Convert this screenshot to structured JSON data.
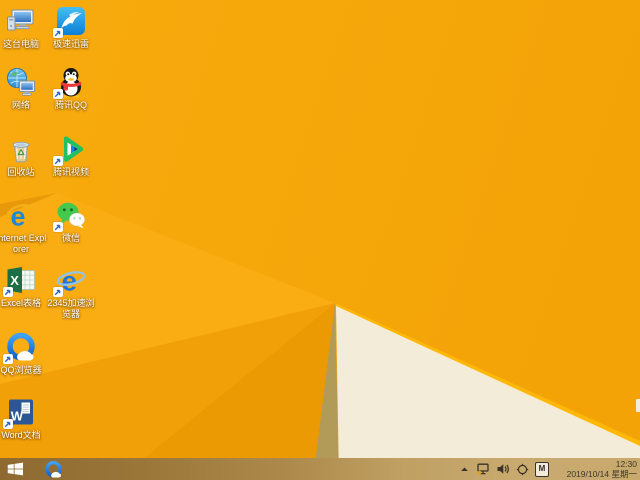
{
  "wallpaper": {
    "base_color": "#f7a90b",
    "base_color_right": "#f3a306",
    "facet_bright": "#f9ad12",
    "facet_crease": "#e8990a",
    "facet_mid": "#f2a008",
    "facet_dark": "#ec9a03",
    "fold_shadow": "#b29a58",
    "fold_cream": "#f3ecd8",
    "fold_edge_highlight": "#ffb808"
  },
  "desktop": {
    "icons": [
      {
        "label": "这台电脑",
        "icon": "this-pc"
      },
      {
        "label": "极速迅雷",
        "icon": "xunlei"
      },
      {
        "label": "网络",
        "icon": "network"
      },
      {
        "label": "腾讯QQ",
        "icon": "qq"
      },
      {
        "label": "回收站",
        "icon": "recycle-bin"
      },
      {
        "label": "腾讯视频",
        "icon": "tencent-video"
      },
      {
        "label": "Internet Explorer",
        "icon": "internet-explorer"
      },
      {
        "label": "微信",
        "icon": "wechat"
      },
      {
        "label": "Excel表格",
        "icon": "excel"
      },
      {
        "label": "2345加速浏览器",
        "icon": "browser-2345"
      },
      {
        "label": "QQ浏览器",
        "icon": "qq-browser"
      },
      {
        "label": "Word文档",
        "icon": "word"
      }
    ]
  },
  "taskbar": {
    "tray": {
      "time": "12:30",
      "date": "2019/10/14 星期一",
      "ime": "M"
    }
  },
  "colors": {
    "taskbar_left": "#8e6a31",
    "taskbar_right": "#c9ab70",
    "tray_icon": "#3a332a",
    "label_text": "#ffffff"
  }
}
